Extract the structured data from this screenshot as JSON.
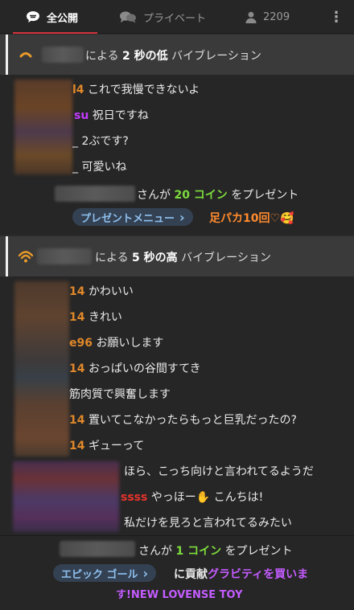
{
  "tabs": {
    "public_label": "全公開",
    "private_label": "プライベート",
    "viewer_count": "2209",
    "more_icon": "⋮"
  },
  "notice1": {
    "prefix": "による",
    "seconds": "2 秒",
    "level_word": "の低",
    "suffix": "バイブレーション",
    "icon": "vibration-low-icon",
    "icon_color": "#e89a2a"
  },
  "chat1": [
    {
      "name": "l4",
      "name_color": "orange",
      "text": "これで我慢できないよ"
    },
    {
      "name": "su",
      "name_color": "purple",
      "text": "祝日ですね"
    },
    {
      "name": "_",
      "name_color": "white",
      "text": "2ぶです?"
    },
    {
      "name": "_",
      "name_color": "white",
      "text": "可愛いね"
    }
  ],
  "gift1": {
    "line_prefix": "さんが",
    "amount": "20 コイン",
    "line_suffix": "をプレゼント",
    "menu_label": "プレゼントメニュー",
    "menu_chevron": "›",
    "link_text": "足パカ10回♡",
    "emoji": "🥰"
  },
  "notice2": {
    "prefix": "による",
    "seconds": "5 秒",
    "level_word": "の高",
    "suffix": "バイブレーション",
    "icon": "vibration-high-icon",
    "icon_color": "#e89a2a"
  },
  "chat2": [
    {
      "name": "14",
      "name_color": "orange",
      "text": "かわいい"
    },
    {
      "name": "14",
      "name_color": "orange",
      "text": "きれい"
    },
    {
      "name": "e96",
      "name_color": "orange",
      "text": "お願いします"
    },
    {
      "name": "14",
      "name_color": "orange",
      "text": "おっぱいの谷間すてき"
    },
    {
      "name": "",
      "name_color": "white",
      "text": "筋肉質で興奮します"
    },
    {
      "name": "14",
      "name_color": "orange",
      "text": "置いてこなかったらもっと巨乳だったの?"
    },
    {
      "name": "14",
      "name_color": "orange",
      "text": "ギューって"
    }
  ],
  "chat3": [
    {
      "name": "",
      "name_color": "white",
      "text": "ほら、こっち向けと言われてるようだ"
    },
    {
      "name": "ssss",
      "name_color": "red",
      "text": "やっほー✋ こんちは!"
    },
    {
      "name": "",
      "name_color": "white",
      "text": "私だけを見ろと言われてるみたい"
    }
  ],
  "gift2": {
    "line_prefix": "さんが",
    "amount": "1 コイン",
    "line_suffix": "をプレゼント",
    "goal_label": "エピック ゴール",
    "goal_chevron": "›",
    "contribute_text": "に貢献",
    "goal_text_1": "グラビティを買いま",
    "goal_text_2": "す!NEW LOVENSE TOY"
  }
}
